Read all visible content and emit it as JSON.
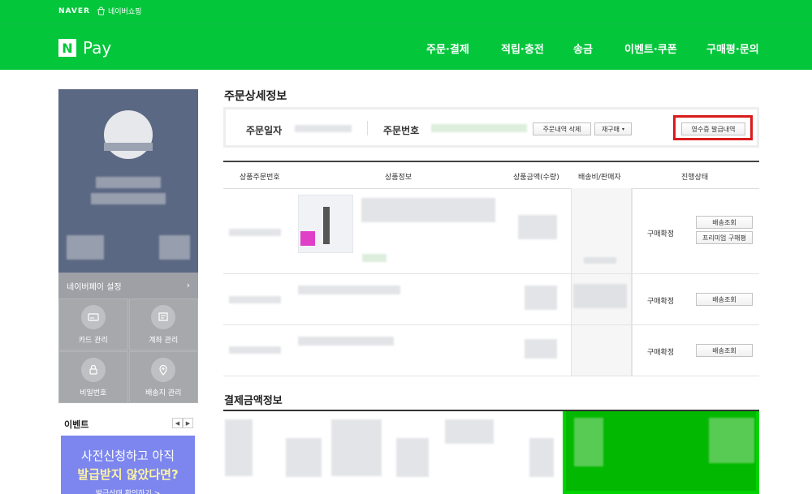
{
  "topbar": {
    "naver_logo": "NAVER",
    "shopping_link": "네이버쇼핑"
  },
  "header": {
    "logo_n": "N",
    "logo_pay": "Pay",
    "nav": [
      "주문·결제",
      "적립·충전",
      "송금",
      "이벤트·쿠폰",
      "구매평·문의"
    ]
  },
  "sidebar": {
    "settings_label": "네이버페이 설정",
    "menu": [
      {
        "label": "카드 관리",
        "icon": "card-icon"
      },
      {
        "label": "계좌 관리",
        "icon": "account-book-icon"
      },
      {
        "label": "비밀번호",
        "icon": "lock-icon"
      },
      {
        "label": "배송지 관리",
        "icon": "location-pin-icon"
      }
    ],
    "event_title": "이벤트",
    "event_nav_prev": "◀",
    "event_nav_next": "▶",
    "banner": {
      "line1": "사전신청하고 아직",
      "line2": "발급받지 않았다면?",
      "line3": "발급상태 확인하기 >"
    }
  },
  "order_detail": {
    "title": "주문상세정보",
    "order_date_label": "주문일자",
    "order_number_label": "주문번호",
    "delete_button": "주문내역 삭제",
    "reorder_button": "재구매",
    "receipt_button": "영수증 발급내역"
  },
  "table": {
    "headers": [
      "상품주문번호",
      "상품정보",
      "상품금액(수량)",
      "배송비/판매자",
      "진행상태"
    ],
    "rows": [
      {
        "status": "구매확정",
        "buttons": [
          "배송조회",
          "프리미엄 구매평"
        ]
      },
      {
        "status": "구매확정",
        "buttons": [
          "배송조회"
        ]
      },
      {
        "status": "구매확정",
        "buttons": [
          "배송조회"
        ]
      }
    ]
  },
  "payment": {
    "title": "결제금액정보"
  },
  "colors": {
    "brand_green": "#03c63b",
    "highlight_red": "#d91b1b"
  }
}
